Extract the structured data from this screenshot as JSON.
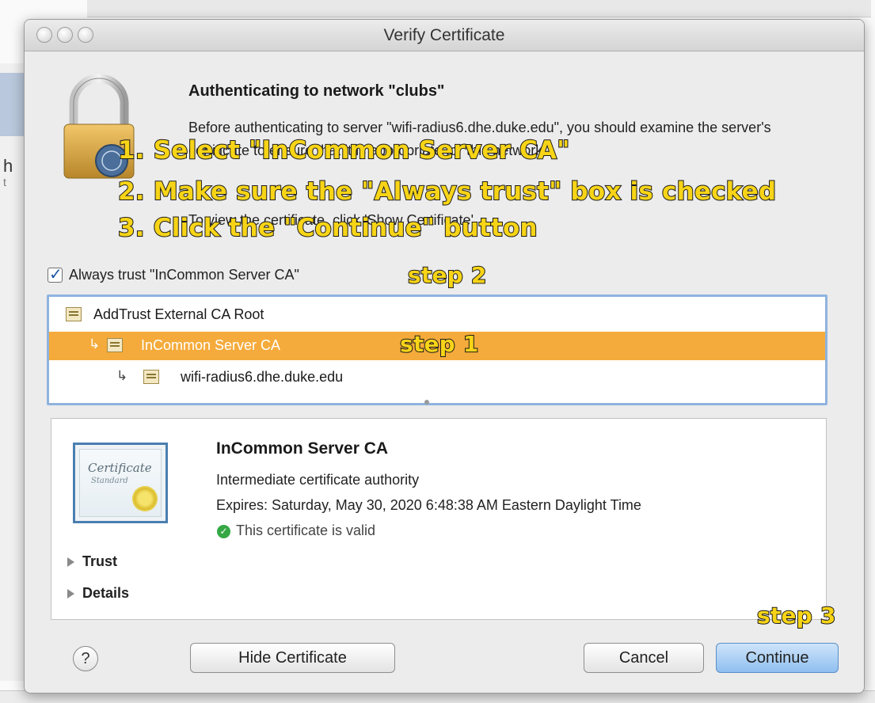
{
  "window": {
    "title": "Verify Certificate"
  },
  "auth": {
    "title": "Authenticating to network \"clubs\"",
    "body": "Before authenticating to server \"wifi-radius6.dhe.duke.edu\", you should examine the server's certificate to ensure that it is appropriate for this network.",
    "tail": "To view the certificate, click 'Show Certificate'."
  },
  "annotations": {
    "step1_instruction": "1. Select \"InCommon Server CA\"",
    "step2_instruction": "2. Make sure the \"Always trust\" box is checked",
    "step3_instruction": "3. Click the \"Continue\" button",
    "label_step2": "step 2",
    "label_step1": "step 1",
    "label_step3": "step 3",
    "color": "#f7d417"
  },
  "trust_checkbox": {
    "label": "Always trust \"InCommon Server CA\"",
    "checked": true
  },
  "cert_chain": [
    {
      "name": "AddTrust External CA Root",
      "selected": false
    },
    {
      "name": "InCommon Server CA",
      "selected": true
    },
    {
      "name": "wifi-radius6.dhe.duke.edu",
      "selected": false
    }
  ],
  "details": {
    "cert_image_text": "Certificate",
    "cert_image_subtext": "Standard",
    "title": "InCommon Server CA",
    "subtitle": "Intermediate certificate authority",
    "expires": "Expires: Saturday, May 30, 2020 6:48:38 AM Eastern Daylight Time",
    "valid": "This certificate is valid",
    "sections": [
      "Trust",
      "Details"
    ]
  },
  "buttons": {
    "help": "?",
    "hide": "Hide Certificate",
    "cancel": "Cancel",
    "continue": "Continue"
  },
  "background": {
    "side_text_1": "h",
    "side_text_2": "t"
  },
  "colors": {
    "selection": "#f5ab3b",
    "focus_ring": "#8fb3df",
    "primary_button": "#8fbff0",
    "valid_green": "#35a844"
  }
}
